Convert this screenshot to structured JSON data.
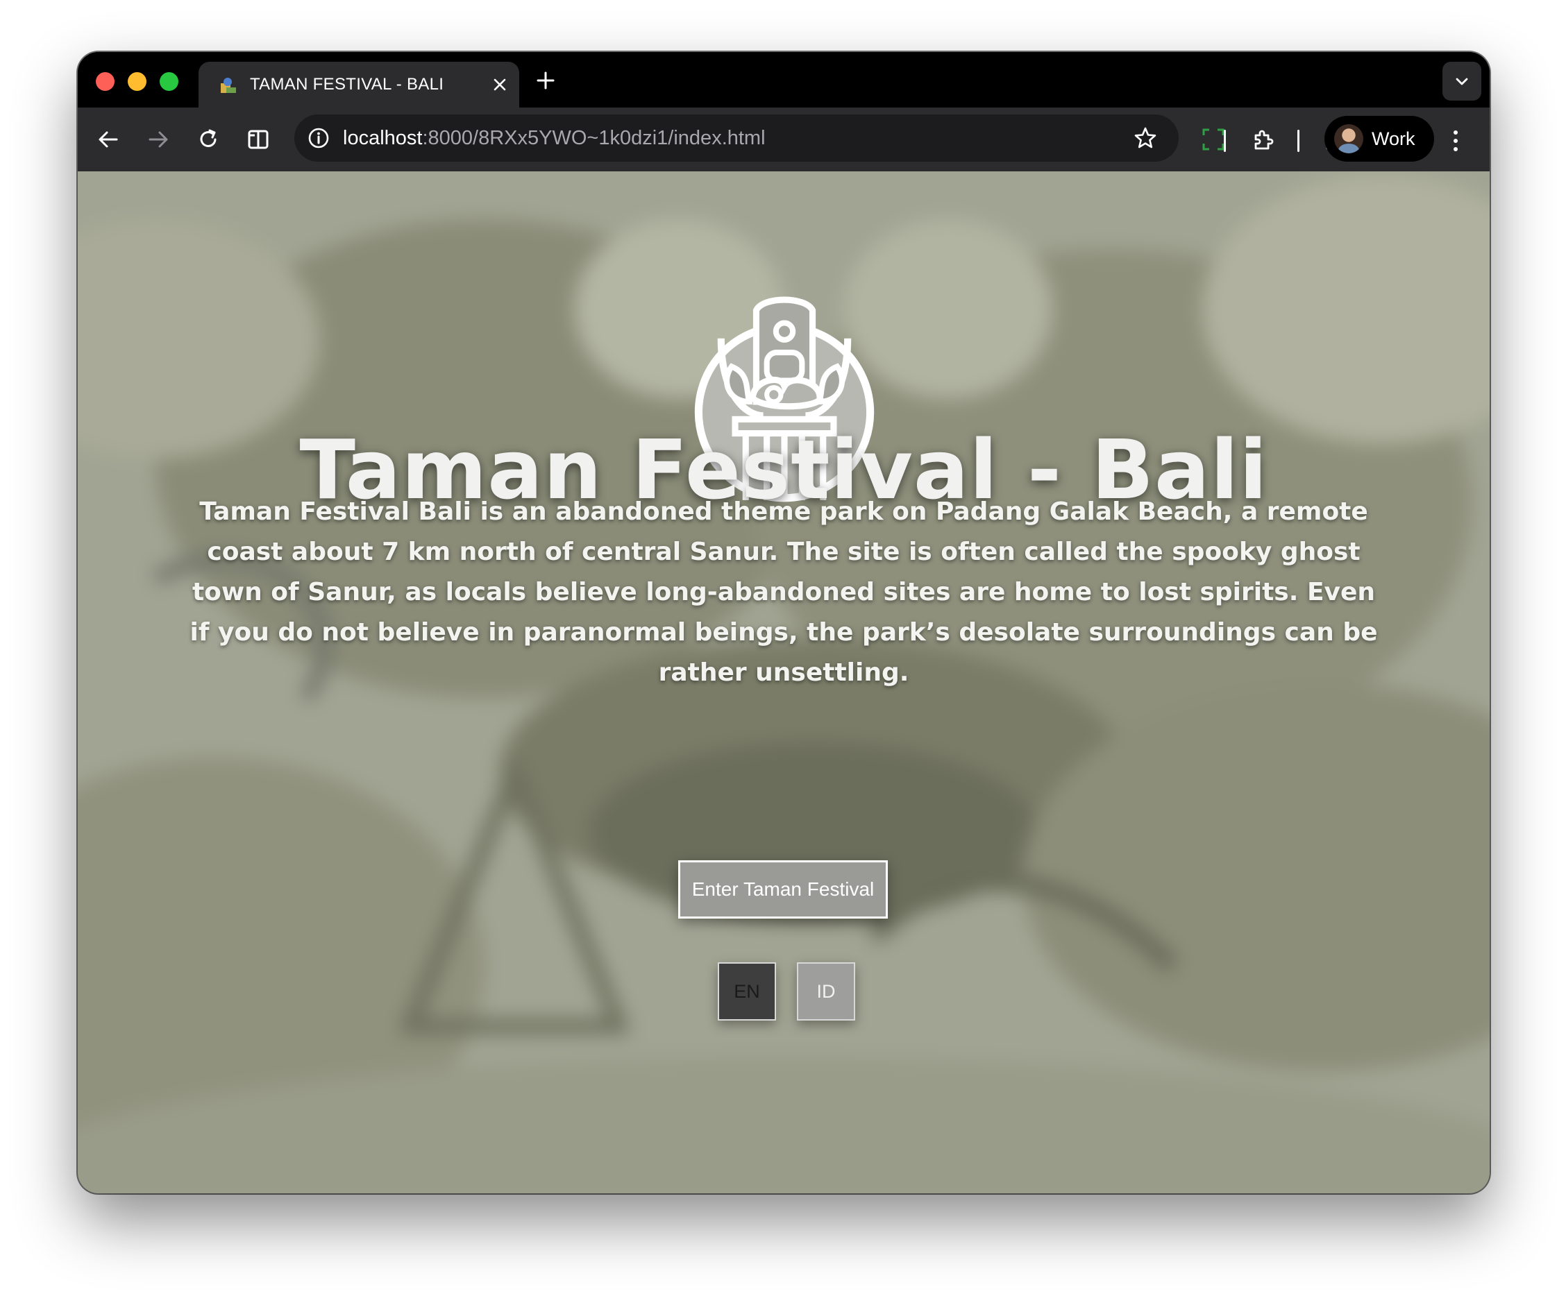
{
  "browser": {
    "tab_title": "TAMAN FESTIVAL - BALI",
    "url_host": "localhost",
    "url_rest": ":8000/8RXx5YWO~1k0dzi1/index.html",
    "profile_name": "Work"
  },
  "hero": {
    "title": "Taman Festival - Bali",
    "description": "Taman Festival Bali is an abandoned theme park on Padang Galak Beach, a remote coast about 7 km north of central Sanur. The site is often called the spooky ghost town of Sanur, as locals believe long-abandoned sites are home to lost spirits. Even if you do not believe in paranormal beings, the park’s desolate surroundings can be rather unsettling.",
    "enter_button": "Enter Taman Festival"
  },
  "language": {
    "options": [
      "EN",
      "ID"
    ],
    "selected": "EN"
  },
  "colors": {
    "page_overlay": "#9ea08e",
    "toolbar": "#2c2c2e",
    "omnibox": "#1c1c1e",
    "active_lang": "#3e3e3e",
    "inactive_lang": "#9e9e9c"
  },
  "icons": [
    "back-arrow-icon",
    "forward-arrow-icon",
    "reload-icon",
    "split-view-icon",
    "site-info-icon",
    "bookmark-star-icon",
    "screenshot-frame-icon",
    "extensions-puzzle-icon",
    "lens-capture-icon",
    "kebab-menu-icon",
    "balinese-temple-logo-icon"
  ]
}
